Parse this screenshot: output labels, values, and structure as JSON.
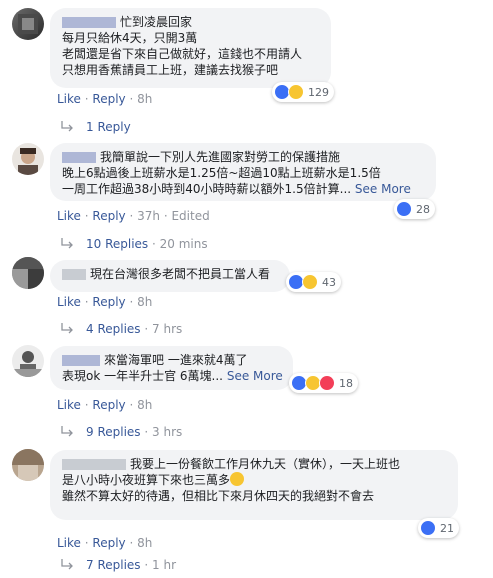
{
  "comments": [
    {
      "name_suffix": "忙到凌晨回家",
      "lines": [
        "每月只給休4天，只開3萬",
        "老闆還是省下來自己做就好，這錢也不用請人",
        "只想用香蕉請員工上班，建議去找猴子吧"
      ],
      "reaction_count": "129",
      "actions": {
        "like": "Like",
        "reply": "Reply",
        "time": "8h"
      },
      "replies": {
        "label": "1 Reply",
        "time": ""
      }
    },
    {
      "name_suffix": "我簡單說一下別人先進國家對勞工的保護措施",
      "lines": [
        "晚上6點過後上班薪水是1.25倍~超過10點上班薪水是1.5倍",
        "一周工作超過38小時到40小時時薪以額外1.5倍計算..."
      ],
      "see_more": "See More",
      "reaction_count": "28",
      "actions": {
        "like": "Like",
        "reply": "Reply",
        "time": "37h",
        "edited": "Edited"
      },
      "replies": {
        "label": "10 Replies",
        "time": "20 mins"
      }
    },
    {
      "name_suffix": "現在台灣很多老闆不把員工當人看",
      "lines": [],
      "reaction_count": "43",
      "actions": {
        "like": "Like",
        "reply": "Reply",
        "time": "8h"
      },
      "replies": {
        "label": "4 Replies",
        "time": "7 hrs"
      }
    },
    {
      "name_suffix": "來當海軍吧 一進來就4萬了",
      "lines": [
        "表現ok 一年半升士官 6萬塊..."
      ],
      "see_more": "See More",
      "reaction_count": "18",
      "actions": {
        "like": "Like",
        "reply": "Reply",
        "time": "8h"
      },
      "replies": {
        "label": "9 Replies",
        "time": "3 hrs"
      }
    },
    {
      "name_suffix": "我要上一份餐飲工作月休九天（實休），一天上班也",
      "lines": [
        "是八小時小夜班算下來也三萬多",
        "雖然不算太好的待遇，但相比下來月休四天的我絕對不會去"
      ],
      "reaction_count": "21",
      "actions": {
        "like": "Like",
        "reply": "Reply",
        "time": "8h"
      },
      "replies": {
        "label": "7 Replies",
        "time": "1 hr"
      }
    }
  ],
  "colors": {
    "link": "#385898",
    "meta": "#90949c",
    "bubble": "#f2f3f5",
    "like": "#3b6ff5",
    "haha": "#f7c531",
    "love": "#f33e58"
  }
}
